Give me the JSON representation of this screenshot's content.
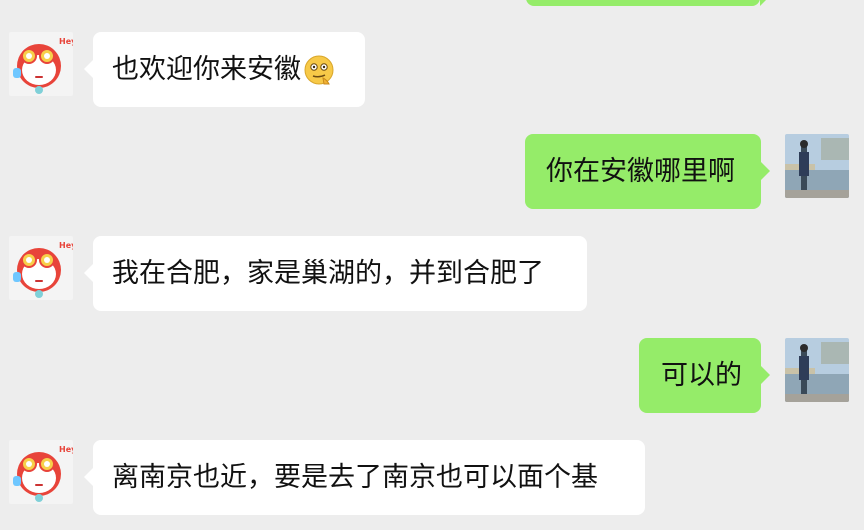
{
  "chat": {
    "messages": [
      {
        "sender": "other",
        "text": "也欢迎你来安徽",
        "emoji": "thinking-face-icon"
      },
      {
        "sender": "me",
        "text": "你在安徽哪里啊"
      },
      {
        "sender": "other",
        "text": "我在合肥，家是巢湖的，并到合肥了"
      },
      {
        "sender": "me",
        "text": "可以的"
      },
      {
        "sender": "other",
        "text": "离南京也近，要是去了南京也可以面个基"
      }
    ],
    "avatar_badge": "Hey!"
  },
  "colors": {
    "background": "#ededed",
    "incoming_bubble": "#ffffff",
    "outgoing_bubble": "#95ec69"
  }
}
